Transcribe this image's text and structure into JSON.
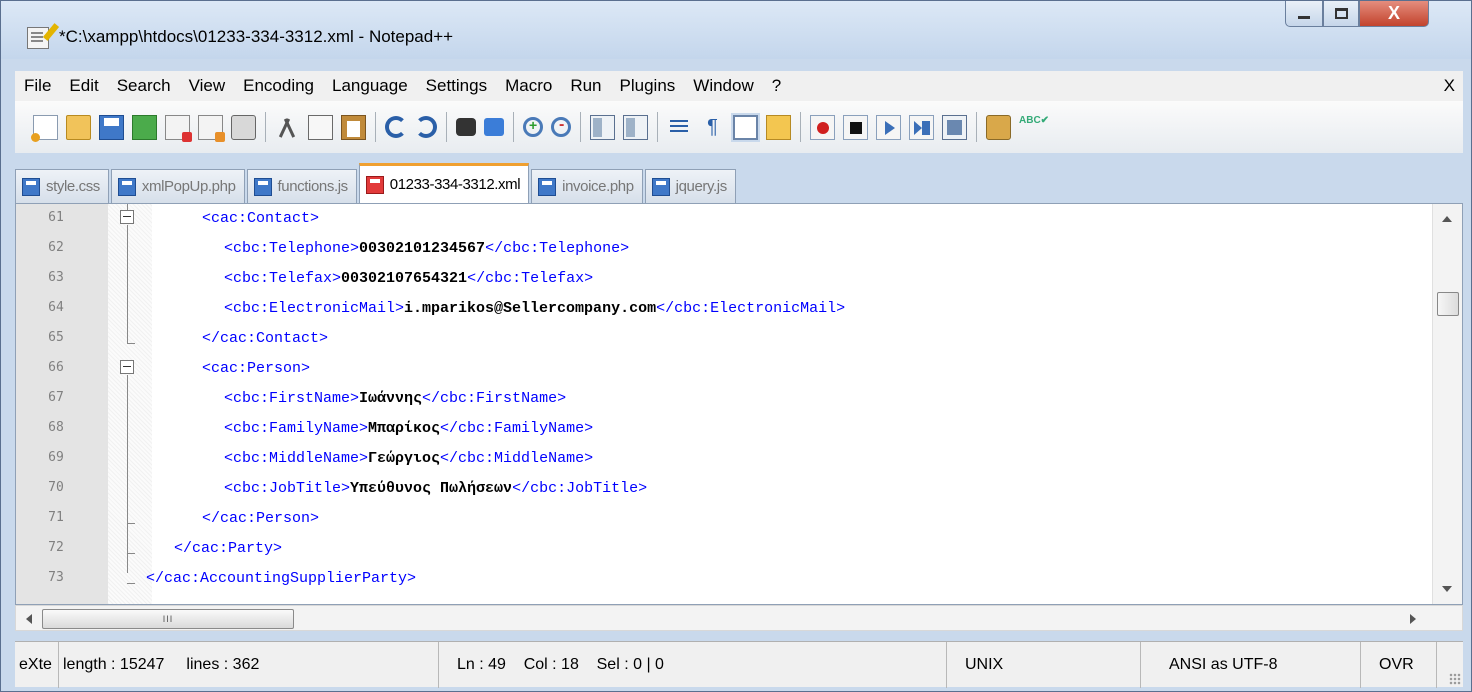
{
  "window": {
    "title": "*C:\\xampp\\htdocs\\01233-334-3312.xml - Notepad++",
    "close_glyph": "X"
  },
  "menu": {
    "items": [
      "File",
      "Edit",
      "Search",
      "View",
      "Encoding",
      "Language",
      "Settings",
      "Macro",
      "Run",
      "Plugins",
      "Window",
      "?"
    ],
    "close_label": "X"
  },
  "toolbar": {
    "icons": [
      "new-file-icon",
      "open-file-icon",
      "save-icon",
      "save-all-icon",
      "close-icon",
      "close-all-icon",
      "print-icon",
      "cut-icon",
      "copy-icon",
      "paste-icon",
      "undo-icon",
      "redo-icon",
      "find-icon",
      "replace-icon",
      "zoom-in-icon",
      "zoom-out-icon",
      "sync-vertical-icon",
      "sync-horizontal-icon",
      "word-wrap-icon",
      "show-all-characters-icon",
      "indent-guide-icon",
      "fold-all-icon",
      "record-macro-icon",
      "stop-recording-icon",
      "playback-icon",
      "run-macro-multiple-icon",
      "save-macro-icon",
      "trim-icon",
      "spell-check-icon"
    ]
  },
  "tabs": [
    {
      "label": "style.css",
      "active": false,
      "unsaved": false
    },
    {
      "label": "xmlPopUp.php",
      "active": false,
      "unsaved": false
    },
    {
      "label": "functions.js",
      "active": false,
      "unsaved": false
    },
    {
      "label": "01233-334-3312.xml",
      "active": true,
      "unsaved": true
    },
    {
      "label": "invoice.php",
      "active": false,
      "unsaved": false
    },
    {
      "label": "jquery.js",
      "active": false,
      "unsaved": false
    }
  ],
  "editor": {
    "lines": [
      {
        "num": "61",
        "open": "<cac:Contact>",
        "text": "",
        "close": ""
      },
      {
        "num": "62",
        "open": "<cbc:Telephone>",
        "text": "00302101234567",
        "close": "</cbc:Telephone>"
      },
      {
        "num": "63",
        "open": "<cbc:Telefax>",
        "text": "00302107654321",
        "close": "</cbc:Telefax>"
      },
      {
        "num": "64",
        "open": "<cbc:ElectronicMail>",
        "text": "i.mparikos@Sellercompany.com",
        "close": "</cbc:ElectronicMail>"
      },
      {
        "num": "65",
        "open": "</cac:Contact>",
        "text": "",
        "close": ""
      },
      {
        "num": "66",
        "open": "<cac:Person>",
        "text": "",
        "close": ""
      },
      {
        "num": "67",
        "open": "<cbc:FirstName>",
        "text": "Ιωάννης",
        "close": "</cbc:FirstName>"
      },
      {
        "num": "68",
        "open": "<cbc:FamilyName>",
        "text": "Μπαρίκος",
        "close": "</cbc:FamilyName>"
      },
      {
        "num": "69",
        "open": "<cbc:MiddleName>",
        "text": "Γεώργιος",
        "close": "</cbc:MiddleName>"
      },
      {
        "num": "70",
        "open": "<cbc:JobTitle>",
        "text": "Υπεύθυνος Πωλήσεων",
        "close": "</cbc:JobTitle>"
      },
      {
        "num": "71",
        "open": "</cac:Person>",
        "text": "",
        "close": ""
      },
      {
        "num": "72",
        "open": "</cac:Party>",
        "text": "",
        "close": ""
      },
      {
        "num": "73",
        "open": "</cac:AccountingSupplierParty>",
        "text": "",
        "close": ""
      }
    ]
  },
  "hscroll": {
    "thumb_grip": "III"
  },
  "status": {
    "type": "eXte",
    "length": "length : 15247",
    "lines": "lines : 362",
    "position": "Ln : 49    Col : 18    Sel : 0 | 0",
    "eol": "UNIX",
    "encoding": "ANSI as UTF-8",
    "mode": "OVR"
  }
}
